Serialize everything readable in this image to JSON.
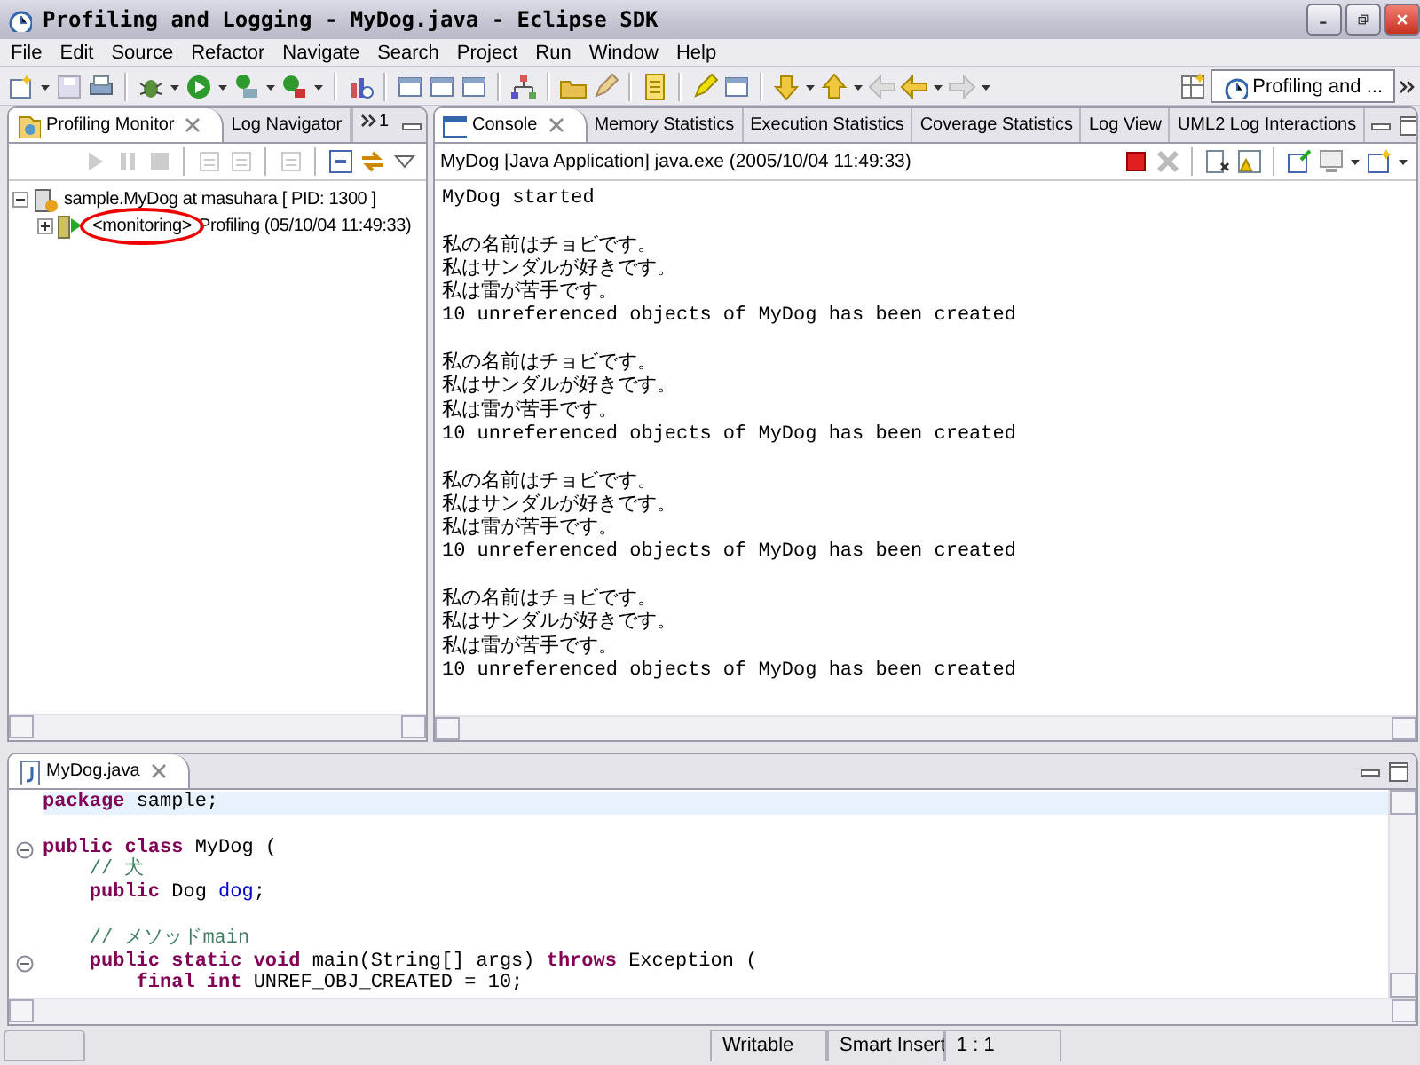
{
  "window": {
    "title": "Profiling and Logging - MyDog.java - Eclipse SDK"
  },
  "menu": [
    "File",
    "Edit",
    "Source",
    "Refactor",
    "Navigate",
    "Search",
    "Project",
    "Run",
    "Window",
    "Help"
  ],
  "perspective": {
    "label": "Profiling and ...",
    "selected": true
  },
  "left_view": {
    "tabs": [
      {
        "label": "Profiling Monitor",
        "selected": true
      },
      {
        "label": "Log Navigator",
        "selected": false
      }
    ],
    "overflow_count": "1",
    "tree": [
      {
        "label": "sample.MyDog at masuhara [ PID: 1300 ]",
        "expanded": true,
        "children": [
          {
            "status": "<monitoring>",
            "label": "Profiling (05/10/04 11:49:33)",
            "circled": true,
            "expanded": false
          }
        ]
      }
    ]
  },
  "console_view": {
    "tabs": [
      {
        "label": "Console",
        "selected": true
      },
      {
        "label": "Memory Statistics",
        "selected": false
      },
      {
        "label": "Execution Statistics",
        "selected": false
      },
      {
        "label": "Coverage Statistics",
        "selected": false
      },
      {
        "label": "Log View",
        "selected": false
      },
      {
        "label": "UML2 Log Interactions",
        "selected": false
      }
    ],
    "process": "MyDog [Java Application] java.exe (2005/10/04 11:49:33)",
    "blocks": [
      [
        "MyDog started"
      ],
      [
        "私の名前はチョビです。",
        "私はサンダルが好きです。",
        "私は雷が苦手です。",
        "10 unreferenced objects of MyDog has been created"
      ],
      [
        "私の名前はチョビです。",
        "私はサンダルが好きです。",
        "私は雷が苦手です。",
        "10 unreferenced objects of MyDog has been created"
      ],
      [
        "私の名前はチョビです。",
        "私はサンダルが好きです。",
        "私は雷が苦手です。",
        "10 unreferenced objects of MyDog has been created"
      ],
      [
        "私の名前はチョビです。",
        "私はサンダルが好きです。",
        "私は雷が苦手です。",
        "10 unreferenced objects of MyDog has been created"
      ]
    ]
  },
  "editor": {
    "tabs": [
      {
        "label": "MyDog.java",
        "selected": true
      }
    ],
    "blocks": [
      [
        {
          "fold": false,
          "current": true,
          "segments": [
            {
              "kind": "keyword",
              "text": "package"
            },
            {
              "kind": "plain",
              "text": " sample;"
            }
          ]
        }
      ],
      [
        {
          "fold": true,
          "current": false,
          "segments": [
            {
              "kind": "keyword",
              "text": "public class"
            },
            {
              "kind": "plain",
              "text": " MyDog ("
            }
          ]
        },
        {
          "fold": false,
          "current": false,
          "segments": [
            {
              "kind": "comment",
              "text": "    // 犬"
            }
          ]
        },
        {
          "fold": false,
          "current": false,
          "segments": [
            {
              "kind": "keyword",
              "text": "    public"
            },
            {
              "kind": "plain",
              "text": " Dog "
            },
            {
              "kind": "field",
              "text": "dog"
            },
            {
              "kind": "plain",
              "text": ";"
            }
          ]
        }
      ],
      [
        {
          "fold": false,
          "current": false,
          "segments": [
            {
              "kind": "comment",
              "text": "    // メソッドmain"
            }
          ]
        },
        {
          "fold": true,
          "current": false,
          "segments": [
            {
              "kind": "keyword",
              "text": "    public static void"
            },
            {
              "kind": "plain",
              "text": " main(String[] args) "
            },
            {
              "kind": "keyword",
              "text": "throws"
            },
            {
              "kind": "plain",
              "text": " Exception ("
            }
          ]
        },
        {
          "fold": false,
          "current": false,
          "segments": [
            {
              "kind": "keyword",
              "text": "        final int"
            },
            {
              "kind": "plain",
              "text": " UNREF_OBJ_CREATED = 10;"
            }
          ]
        }
      ]
    ]
  },
  "status_bar": [
    "Writable",
    "Smart Insert",
    "1 : 1"
  ]
}
